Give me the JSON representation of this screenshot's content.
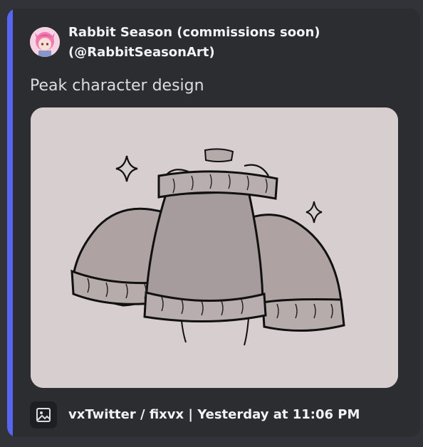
{
  "embed": {
    "accent_color": "#5865f2",
    "author": {
      "name": "Rabbit Season (commissions soon)",
      "handle": "(@RabbitSeasonArt)",
      "avatar_icon": "avatar-pink-hair"
    },
    "description": "Peak character design",
    "image": {
      "icon": "sweater-sketch-image"
    },
    "footer": {
      "icon": "image-icon",
      "text": "vxTwitter / fixvx | Yesterday at 11:06 PM"
    }
  }
}
